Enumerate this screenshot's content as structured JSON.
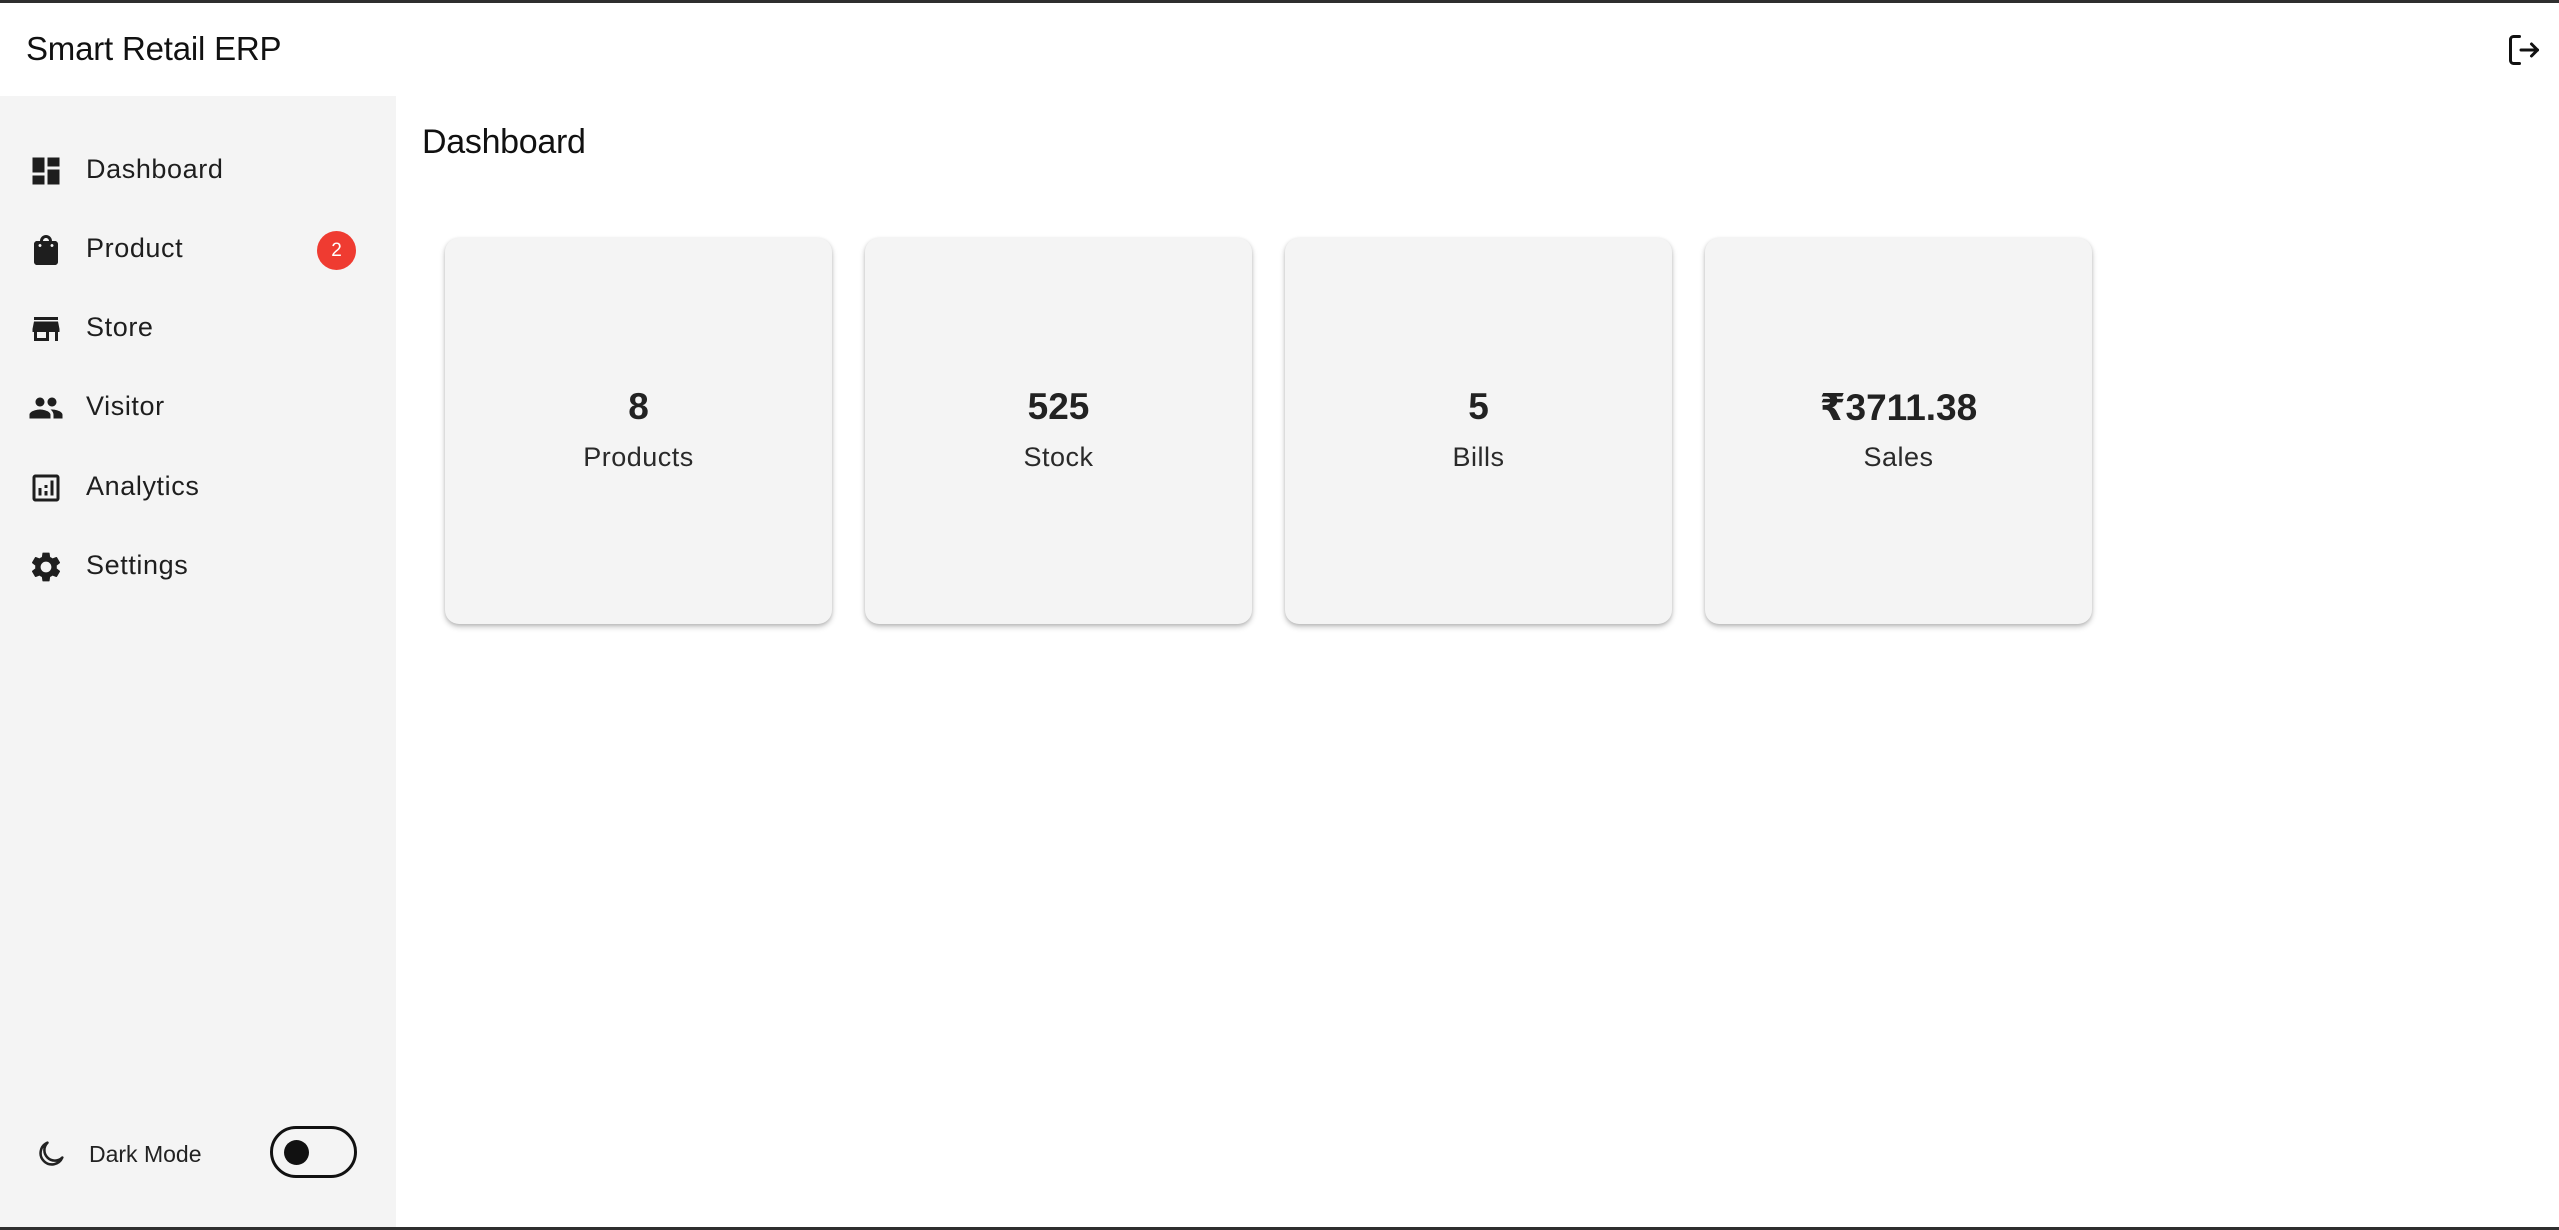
{
  "app": {
    "title": "Smart Retail ERP"
  },
  "header": {
    "logout_icon": "logout-icon"
  },
  "sidebar": {
    "items": [
      {
        "label": "Dashboard",
        "icon": "dashboard-icon"
      },
      {
        "label": "Product",
        "icon": "shopping-bag-icon",
        "badge": "2"
      },
      {
        "label": "Store",
        "icon": "store-icon"
      },
      {
        "label": "Visitor",
        "icon": "people-icon"
      },
      {
        "label": "Analytics",
        "icon": "analytics-icon"
      },
      {
        "label": "Settings",
        "icon": "gear-icon"
      }
    ],
    "dark_mode": {
      "label": "Dark Mode",
      "icon": "moon-icon",
      "enabled": false
    }
  },
  "main": {
    "title": "Dashboard",
    "cards": [
      {
        "value": "8",
        "label": "Products"
      },
      {
        "value": "525",
        "label": "Stock"
      },
      {
        "value": "5",
        "label": "Bills"
      },
      {
        "value": "₹3711.38",
        "label": "Sales"
      }
    ]
  },
  "colors": {
    "badge": "#ef3b31",
    "sidebar_bg": "#f4f4f4",
    "card_bg": "#f4f4f4"
  }
}
